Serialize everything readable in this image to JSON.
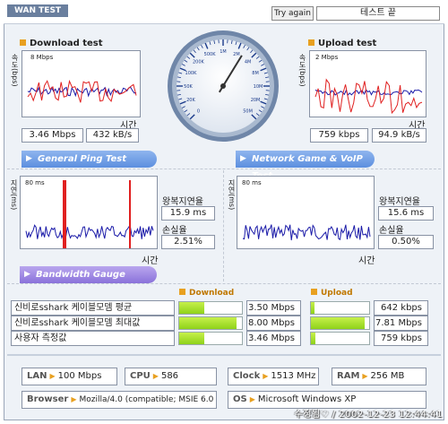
{
  "header": {
    "tab_label": "WAN TEST",
    "try_again_label": "Try again",
    "test_end_label": "테스트 끝"
  },
  "download": {
    "title": "Download test",
    "ylabel": "속도(bps)",
    "scale": "8 Mbps",
    "xlabel": "시간",
    "mbps": "3.46 Mbps",
    "kbs": "432 kB/s"
  },
  "upload": {
    "title": "Upload test",
    "ylabel": "속도(bps)",
    "scale": "2 Mbps",
    "xlabel": "시간",
    "kbps": "759 kbps",
    "kbs": "94.9 kB/s"
  },
  "gauge": {
    "ticks": [
      "0",
      "20K",
      "50K",
      "100K",
      "200K",
      "500K",
      "1M",
      "2M",
      "4M",
      "8M",
      "10M",
      "20M",
      "50M"
    ],
    "needle_value": "3.46 Mbps"
  },
  "ping": {
    "section_label": "General Ping Test",
    "ylabel": "지연(ms)",
    "scale": "80 ms",
    "xlabel": "시간",
    "latency_label": "왕복지연율",
    "latency": "15.9 ms",
    "loss_label": "손실율",
    "loss": "2.51%"
  },
  "game": {
    "section_label": "Network Game & VoIP Test",
    "ylabel": "지연(ms)",
    "scale": "80 ms",
    "xlabel": "시간",
    "latency_label": "왕복지연율",
    "latency": "15.6 ms",
    "loss_label": "손실율",
    "loss": "0.50%"
  },
  "bandwidth": {
    "section_label": "Bandwidth Gauge",
    "download_header": "Download",
    "upload_header": "Upload",
    "rows": [
      {
        "name": "신비로sshark 케이블모뎀 평균",
        "down": "3.50 Mbps",
        "down_pct": 0.4,
        "up": "642 kbps",
        "up_pct": 0.06
      },
      {
        "name": "신비로sshark 케이블모뎀 최대값",
        "down": "8.00 Mbps",
        "down_pct": 0.92,
        "up": "7.81 Mbps",
        "up_pct": 0.92
      },
      {
        "name": "사용자 측정값",
        "down": "3.46 Mbps",
        "down_pct": 0.4,
        "up": "759 kbps",
        "up_pct": 0.07
      }
    ]
  },
  "system": {
    "lan_key": "LAN",
    "lan": "100 Mbps",
    "cpu_key": "CPU",
    "cpu": "586",
    "clock_key": "Clock",
    "clock": "1513 MHz",
    "ram_key": "RAM",
    "ram": "256 MB",
    "browser_key": "Browser",
    "browser": "Mozilla/4.0 (compatible; MSIE 6.0",
    "os_key": "OS",
    "os": "Microsoft Windows XP"
  },
  "footer": "수정됨♡ / 2002-12-23 12:44:41",
  "colors": {
    "series_red": "#e02020",
    "series_blue": "#1a1aa8",
    "accent": "#e8a020",
    "bar_green": "#a6e030"
  }
}
